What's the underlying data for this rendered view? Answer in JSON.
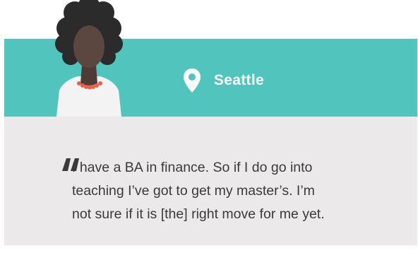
{
  "location": {
    "icon": "map-pin-icon",
    "city": "Seattle"
  },
  "quote": {
    "icon": "quotation-mark-icon",
    "lines": [
      "I have a BA in finance. So if I do go into",
      "teaching I’ve got to get my master’s. I’m",
      "not sure if it is [the] right move for me yet."
    ]
  },
  "colors": {
    "banner": "#51c4be",
    "panel": "#ebe9ea",
    "text": "#3a3a3a",
    "hair": "#2b2b2b",
    "skin": "#5b4740",
    "necklace": "#e8604c",
    "shirt": "#f3f3f3"
  }
}
